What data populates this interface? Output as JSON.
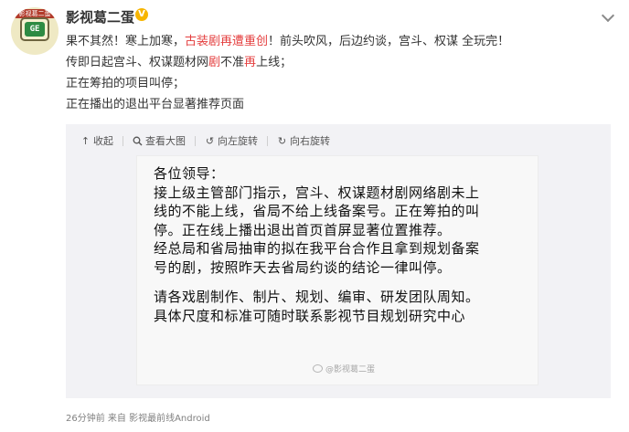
{
  "user": {
    "name": "影视葛二蛋",
    "avatar_tag": "影视葛二蛋",
    "avatar_screen": "GE"
  },
  "icons": {
    "verified": "verified-badge-icon",
    "menu": "chevron-down-icon",
    "collapse": "arrow-up-icon",
    "view_large": "magnifier-icon",
    "rotate_left": "rotate-left-icon",
    "rotate_right": "rotate-right-icon",
    "watermark": "weibo-logo-icon"
  },
  "post": {
    "line1_a": "果不其然！寒上加寒，",
    "line1_red": "古装剧再遭重创",
    "line1_b": "！前头吹风，后边约谈，宫斗、权谋 全玩完！",
    "line2_a": "传即日起宫斗、权谋题材网",
    "line2_red1": "剧",
    "line2_b": "不准",
    "line2_red2": "再",
    "line2_c": "上线；",
    "line3": "正在筹拍的项目叫停；",
    "line4": "正在播出的退出平台显著推荐页面"
  },
  "toolbar": {
    "collapse": "收起",
    "view_large": "查看大图",
    "rotate_left": "向左旋转",
    "rotate_right": "向右旋转"
  },
  "image_text": {
    "l1": "各位领导：",
    "l2": "接上级主管部门指示，宫斗、权谋题材剧网络剧未上",
    "l3": "线的不能上线，省局不给上线备案号。正在筹拍的叫",
    "l4": "停。正在线上播出退出首页首屏显著位置推荐。",
    "l5": "经总局和省局抽审的拟在我平台合作且拿到规划备案",
    "l6": "号的剧，按照昨天去省局约谈的结论一律叫停。",
    "l7": "请各戏剧制作、制片、规划、编审、研发团队周知。",
    "l8": "具体尺度和标准可随时联系影视节目规划研究中心",
    "watermark": "@影视葛二蛋"
  },
  "footer": {
    "meta": "26分钟前 来自 影视最前线Android"
  },
  "colors": {
    "accent_red": "#e43e3e",
    "verified": "#f7b500",
    "media_bg": "#f2f2f5"
  }
}
